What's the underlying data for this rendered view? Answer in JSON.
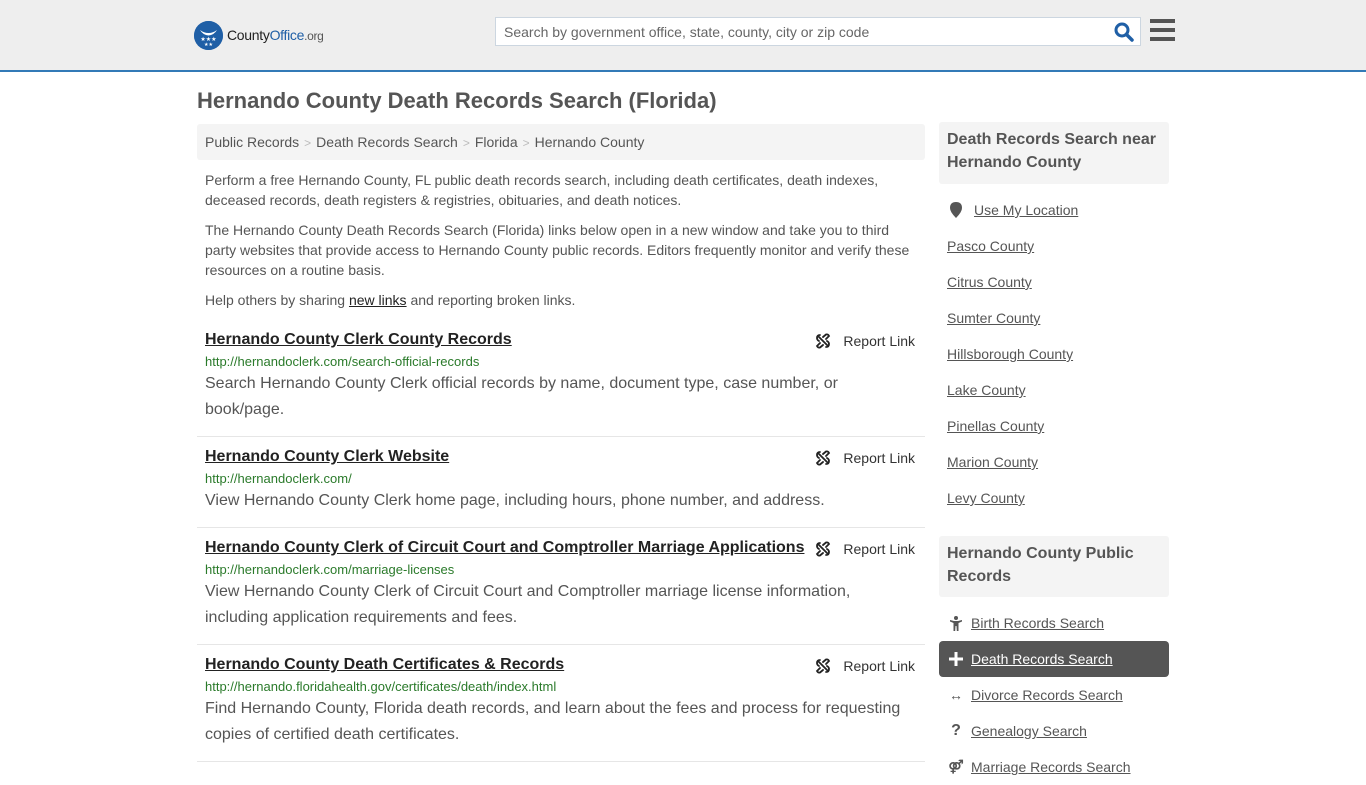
{
  "header": {
    "logo": {
      "name": "CountyOffice",
      "name_plain": "County",
      "name_brand": "Office",
      "tld": ".org"
    },
    "search": {
      "placeholder": "Search by government office, state, county, city or zip code",
      "value": ""
    },
    "icons": {
      "search": "search-icon",
      "menu": "hamburger-menu-icon"
    }
  },
  "page": {
    "title": "Hernando County Death Records Search (Florida)"
  },
  "breadcrumb": [
    "Public Records",
    "Death Records Search",
    "Florida",
    "Hernando County"
  ],
  "intro": {
    "p1": "Perform a free Hernando County, FL public death records search, including death certificates, death indexes, deceased records, death registers & registries, obituaries, and death notices.",
    "p2": "The Hernando County Death Records Search (Florida) links below open in a new window and take you to third party websites that provide access to Hernando County public records. Editors frequently monitor and verify these resources on a routine basis.",
    "p3_before": "Help others by sharing ",
    "p3_link": "new links",
    "p3_after": " and reporting broken links."
  },
  "results": [
    {
      "title": "Hernando County Clerk County Records",
      "url": "http://hernandoclerk.com/search-official-records",
      "description": "Search Hernando County Clerk official records by name, document type, case number, or book/page.",
      "report_label": "Report Link"
    },
    {
      "title": "Hernando County Clerk Website",
      "url": "http://hernandoclerk.com/",
      "description": "View Hernando County Clerk home page, including hours, phone number, and address.",
      "report_label": "Report Link"
    },
    {
      "title": "Hernando County Clerk of Circuit Court and Comptroller Marriage Applications",
      "url": "http://hernandoclerk.com/marriage-licenses",
      "description": "View Hernando County Clerk of Circuit Court and Comptroller marriage license information, including application requirements and fees.",
      "report_label": "Report Link"
    },
    {
      "title": "Hernando County Death Certificates & Records",
      "url": "http://hernando.floridahealth.gov/certificates/death/index.html",
      "description": "Find Hernando County, Florida death records, and learn about the fees and process for requesting copies of certified death certificates.",
      "report_label": "Report Link"
    }
  ],
  "sidebar": {
    "nearby": {
      "heading": "Death Records Search near Hernando County",
      "use_location": "Use My Location",
      "counties": [
        "Pasco County",
        "Citrus County",
        "Sumter County",
        "Hillsborough County",
        "Lake County",
        "Pinellas County",
        "Marion County",
        "Levy County"
      ]
    },
    "public_records": {
      "heading": "Hernando County Public Records",
      "items": [
        {
          "label": "Birth Records Search",
          "icon": "child-icon",
          "active": false
        },
        {
          "label": "Death Records Search",
          "icon": "plus-icon",
          "active": true
        },
        {
          "label": "Divorce Records Search",
          "icon": "arrows-horizontal-icon",
          "active": false
        },
        {
          "label": "Genealogy Search",
          "icon": "question-icon",
          "active": false
        },
        {
          "label": "Marriage Records Search",
          "icon": "marriage-symbol-icon",
          "active": false
        }
      ]
    }
  },
  "colors": {
    "accent": "#337ab7",
    "brand": "#1f5fa6",
    "url_green": "#2a7a2a",
    "active_bg": "#555555"
  }
}
